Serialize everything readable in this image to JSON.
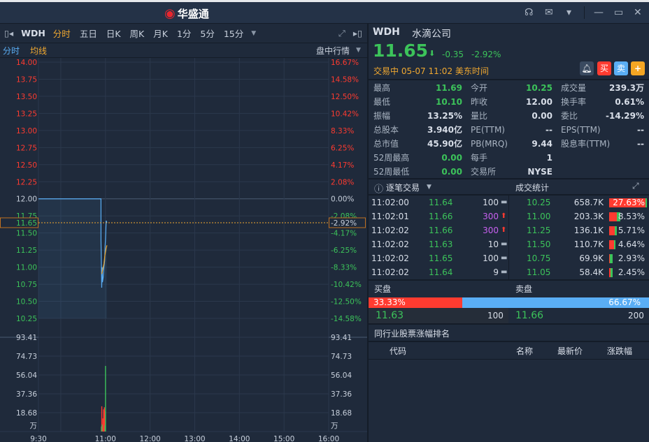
{
  "app": {
    "title": "华盛通"
  },
  "window_controls": [
    "headset-icon",
    "mail-icon",
    "shirt-icon",
    "minimize-icon",
    "maximize-icon",
    "close-icon"
  ],
  "toolbar": {
    "symbol": "WDH",
    "tabs": [
      "分时",
      "五日",
      "日K",
      "周K",
      "月K",
      "1分",
      "5分",
      "15分"
    ],
    "active": "分时"
  },
  "subbar": {
    "legend_time": "分时",
    "legend_avg": "均线",
    "mode": "盘中行情"
  },
  "colors": {
    "up": "#ff3b30",
    "down": "#3cc35a",
    "line": "#5aaef5",
    "avg": "#f0a830"
  },
  "chart_data": {
    "type": "line",
    "prev_close": 12.0,
    "current": "11.65",
    "current_pct": "-2.92%",
    "price_ticks": [
      "14.00",
      "13.75",
      "13.50",
      "13.25",
      "13.00",
      "12.75",
      "12.50",
      "12.25",
      "12.00",
      "11.75",
      "11.50",
      "11.25",
      "11.00",
      "10.75",
      "10.50",
      "10.25"
    ],
    "pct_ticks": [
      "16.67%",
      "14.58%",
      "12.50%",
      "10.42%",
      "8.33%",
      "6.25%",
      "4.17%",
      "2.08%",
      "0.00%",
      "-2.08%",
      "-4.17%",
      "-6.25%",
      "-8.33%",
      "-10.42%",
      "-12.50%",
      "-14.58%"
    ],
    "ylim": [
      10.25,
      14.0
    ],
    "x_ticks": [
      "9:30",
      "11:00",
      "12:00",
      "13:00",
      "14:00",
      "15:00",
      "16:00"
    ],
    "price": [
      [
        0,
        12.0
      ],
      [
        84,
        12.0
      ],
      [
        84,
        11.4
      ],
      [
        85,
        10.7
      ],
      [
        85.5,
        11.0
      ],
      [
        86,
        10.78
      ],
      [
        87,
        10.85
      ],
      [
        88,
        11.0
      ],
      [
        89,
        11.1
      ],
      [
        89.5,
        11.3
      ],
      [
        90,
        11.4
      ],
      [
        90.5,
        11.55
      ],
      [
        91,
        11.68
      ],
      [
        92,
        11.65
      ]
    ],
    "avg": [
      [
        85,
        10.9
      ],
      [
        86,
        10.95
      ],
      [
        87,
        11.0
      ],
      [
        88,
        11.05
      ],
      [
        89,
        11.15
      ],
      [
        90,
        11.22
      ],
      [
        91,
        11.28
      ],
      [
        92,
        11.32
      ]
    ],
    "volume_ticks": [
      "93.41",
      "74.73",
      "56.04",
      "37.36",
      "18.68"
    ],
    "volume_unit": "万",
    "volume_max": 93.41,
    "volume": [
      [
        84.5,
        5,
        "down"
      ],
      [
        85,
        25,
        "up"
      ],
      [
        85.5,
        7,
        "down"
      ],
      [
        86,
        6,
        "down"
      ],
      [
        86.5,
        13,
        "up"
      ],
      [
        87,
        11,
        "up"
      ],
      [
        87.5,
        22,
        "up"
      ],
      [
        88,
        16,
        "up"
      ],
      [
        88.5,
        24,
        "up"
      ],
      [
        89,
        20,
        "up"
      ],
      [
        89.5,
        6,
        "down"
      ],
      [
        90,
        65,
        "down"
      ]
    ]
  },
  "quote": {
    "symbol": "WDH",
    "name": "水滴公司",
    "price": "11.65",
    "change": "-0.35",
    "change_pct": "-2.92%",
    "status": "交易中 05-07 11:02 美东时间",
    "buy": "买",
    "sell": "卖",
    "add": "+"
  },
  "stats": [
    [
      [
        "最高",
        "11.69",
        "g"
      ],
      [
        "今开",
        "10.25",
        "g"
      ],
      [
        "成交量",
        "239.3万",
        "w"
      ]
    ],
    [
      [
        "最低",
        "10.10",
        "g"
      ],
      [
        "昨收",
        "12.00",
        "w"
      ],
      [
        "换手率",
        "0.61%",
        "w"
      ]
    ],
    [
      [
        "振幅",
        "13.25%",
        "w"
      ],
      [
        "量比",
        "0.00",
        "w"
      ],
      [
        "委比",
        "-14.29%",
        "w"
      ]
    ],
    [
      [
        "总股本",
        "3.940亿",
        "w"
      ],
      [
        "PE(TTM)",
        "--",
        "w"
      ],
      [
        "EPS(TTM)",
        "--",
        "w"
      ]
    ],
    [
      [
        "总市值",
        "45.90亿",
        "w"
      ],
      [
        "PB(MRQ)",
        "9.44",
        "w"
      ],
      [
        "股息率(TTM)",
        "--",
        "w"
      ]
    ],
    [
      [
        "52周最高",
        "0.00",
        "g"
      ],
      [
        "每手",
        "1",
        "w"
      ],
      [
        "",
        ""
      ]
    ],
    [
      [
        "52周最低",
        "0.00",
        "g"
      ],
      [
        "交易所",
        "NYSE",
        "w"
      ],
      [
        "",
        ""
      ]
    ]
  ],
  "ticks_header": {
    "title": "逐笔交易",
    "stats_title": "成交统计"
  },
  "ticks": [
    {
      "time": "11:02:00",
      "price": "11.64",
      "vol": "100",
      "dir": "flat"
    },
    {
      "time": "11:02:01",
      "price": "11.66",
      "vol": "300",
      "dir": "up"
    },
    {
      "time": "11:02:02",
      "price": "11.66",
      "vol": "300",
      "dir": "up"
    },
    {
      "time": "11:02:02",
      "price": "11.63",
      "vol": "10",
      "dir": "flat"
    },
    {
      "time": "11:02:02",
      "price": "11.65",
      "vol": "100",
      "dir": "flat"
    },
    {
      "time": "11:02:02",
      "price": "11.64",
      "vol": "9",
      "dir": "flat"
    }
  ],
  "trade_stats": [
    {
      "price": "10.25",
      "vol": "658.7K",
      "pct": "27.63%",
      "buy": 27.63,
      "sell": 1
    },
    {
      "price": "11.00",
      "vol": "203.3K",
      "pct": "8.53%",
      "buy": 6,
      "sell": 2.5
    },
    {
      "price": "11.25",
      "vol": "136.1K",
      "pct": "5.71%",
      "buy": 4,
      "sell": 1.7
    },
    {
      "price": "11.50",
      "vol": "110.7K",
      "pct": "4.64%",
      "buy": 3.8,
      "sell": 0.8
    },
    {
      "price": "10.75",
      "vol": "69.9K",
      "pct": "2.93%",
      "buy": 0.5,
      "sell": 2.4
    },
    {
      "price": "11.05",
      "vol": "58.4K",
      "pct": "2.45%",
      "buy": 1.2,
      "sell": 1.2
    }
  ],
  "book": {
    "bid_label": "买盘",
    "ask_label": "卖盘",
    "bid_pct": "33.33%",
    "ask_pct": "66.67%",
    "bid_ratio": 33.33,
    "bid_price": "11.63",
    "bid_vol": "100",
    "ask_price": "11.66",
    "ask_vol": "200"
  },
  "peers": {
    "title": "同行业股票涨幅排名",
    "cols": [
      "代码",
      "名称",
      "最新价",
      "涨跌幅"
    ]
  }
}
